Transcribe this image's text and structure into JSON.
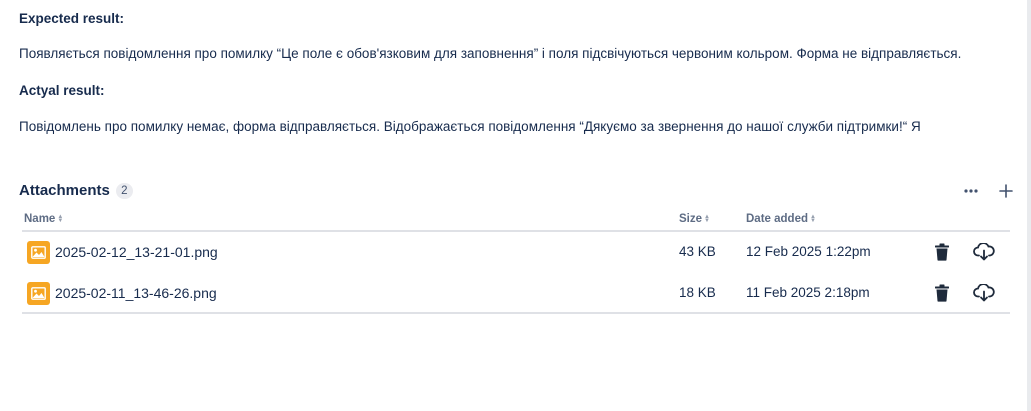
{
  "expected": {
    "title": "Expected result:",
    "body": "Появляється повідомлення про помилку “Це поле є обов'язковим для заповнення” і поля підсвічуються червоним кольром. Форма не відправляється."
  },
  "actual": {
    "title": "Actyal result:",
    "body": "Повідомлень про помилку немає, форма відправляється. Відображається повідомлення “Дякуємо за звернення до нашої служби підтримки!“ Я"
  },
  "attachments": {
    "title": "Attachments",
    "count": "2",
    "columns": {
      "name": "Name",
      "size": "Size",
      "date": "Date added"
    },
    "rows": [
      {
        "name": "2025-02-12_13-21-01.png",
        "size": "43 KB",
        "date": "12 Feb 2025 1:22pm",
        "icon": "image-icon"
      },
      {
        "name": "2025-02-11_13-46-26.png",
        "size": "18 KB",
        "date": "11 Feb 2025 2:18pm",
        "icon": "image-icon"
      }
    ],
    "actions": {
      "more_icon": "more-horizontal-icon",
      "add_icon": "plus-icon"
    }
  },
  "colors": {
    "text": "#172b4d",
    "muted": "#5e6c84",
    "thumbnail": "#f6a623",
    "divider": "#dfe1e6"
  }
}
